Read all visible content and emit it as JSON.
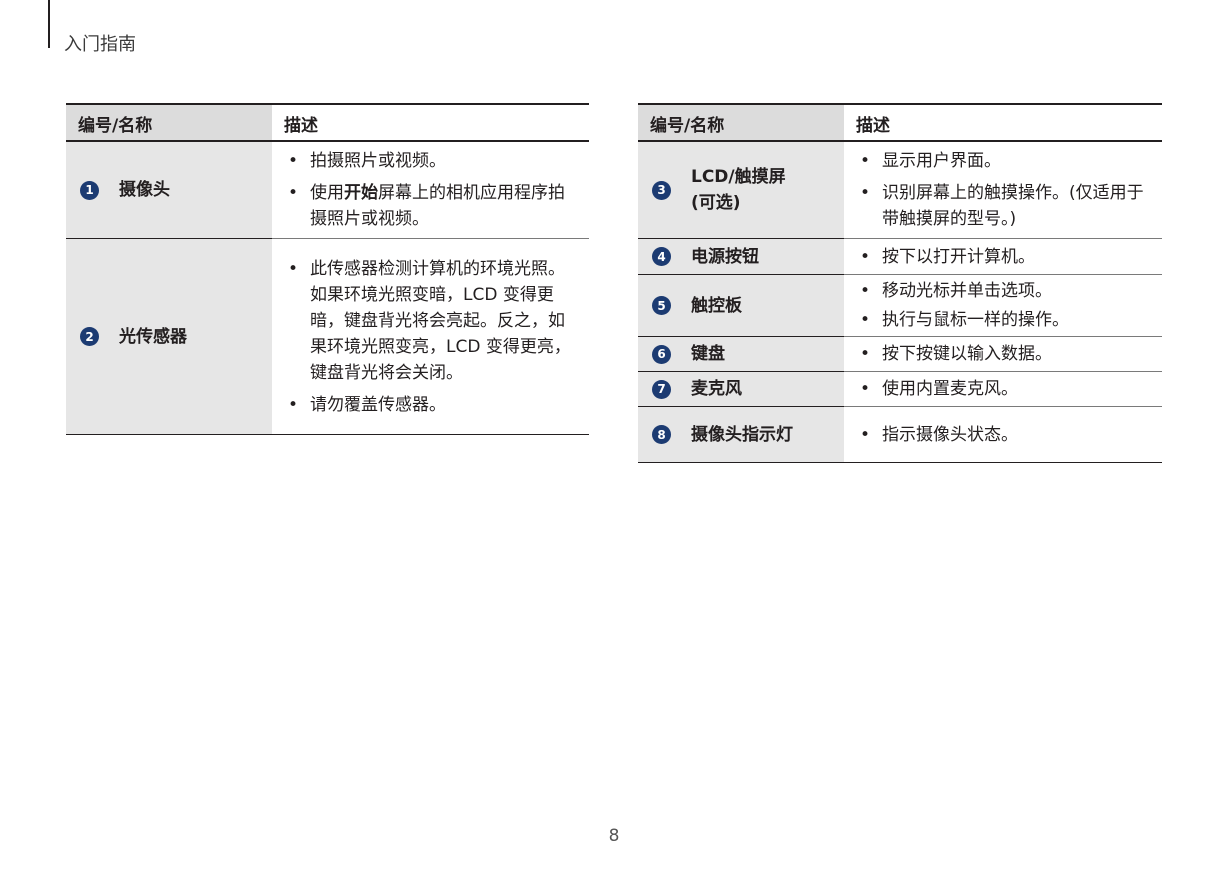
{
  "header": {
    "section_title": "入门指南"
  },
  "table_headers": {
    "name": "编号/名称",
    "desc": "描述"
  },
  "bullet_char": "•",
  "left_table": {
    "rows": [
      {
        "num": "1",
        "name": "摄像头",
        "bullets": [
          {
            "text": "拍摄照片或视频。"
          },
          {
            "pre": "使用",
            "bold": "开始",
            "post": "屏幕上的相机应用程序拍摄照片或视频。"
          }
        ]
      },
      {
        "num": "2",
        "name": "光传感器",
        "bullets": [
          {
            "text": "此传感器检测计算机的环境光照。如果环境光照变暗，LCD 变得更暗，键盘背光将会亮起。反之，如果环境光照变亮，LCD 变得更亮，键盘背光将会关闭。"
          },
          {
            "text": "请勿覆盖传感器。"
          }
        ]
      }
    ]
  },
  "right_table": {
    "rows": [
      {
        "num": "3",
        "name": "LCD/触摸屏 (可选)",
        "bullets": [
          {
            "text": "显示用户界面。"
          },
          {
            "text": "识别屏幕上的触摸操作。(仅适用于带触摸屏的型号。)"
          }
        ]
      },
      {
        "num": "4",
        "name": "电源按钮",
        "bullets": [
          {
            "text": "按下以打开计算机。"
          }
        ]
      },
      {
        "num": "5",
        "name": "触控板",
        "bullets": [
          {
            "text": "移动光标并单击选项。"
          },
          {
            "text": "执行与鼠标一样的操作。"
          }
        ]
      },
      {
        "num": "6",
        "name": "键盘",
        "bullets": [
          {
            "text": "按下按键以输入数据。"
          }
        ]
      },
      {
        "num": "7",
        "name": "麦克风",
        "bullets": [
          {
            "text": "使用内置麦克风。"
          }
        ]
      },
      {
        "num": "8",
        "name": "摄像头指示灯",
        "bullets": [
          {
            "text": "指示摄像头状态。"
          }
        ]
      }
    ]
  },
  "footer": {
    "page_number": "8"
  },
  "colors": {
    "badge": "#1c3b72",
    "name_column_bg": "#e6e6e6",
    "header_bg": "#dcdcdc"
  }
}
